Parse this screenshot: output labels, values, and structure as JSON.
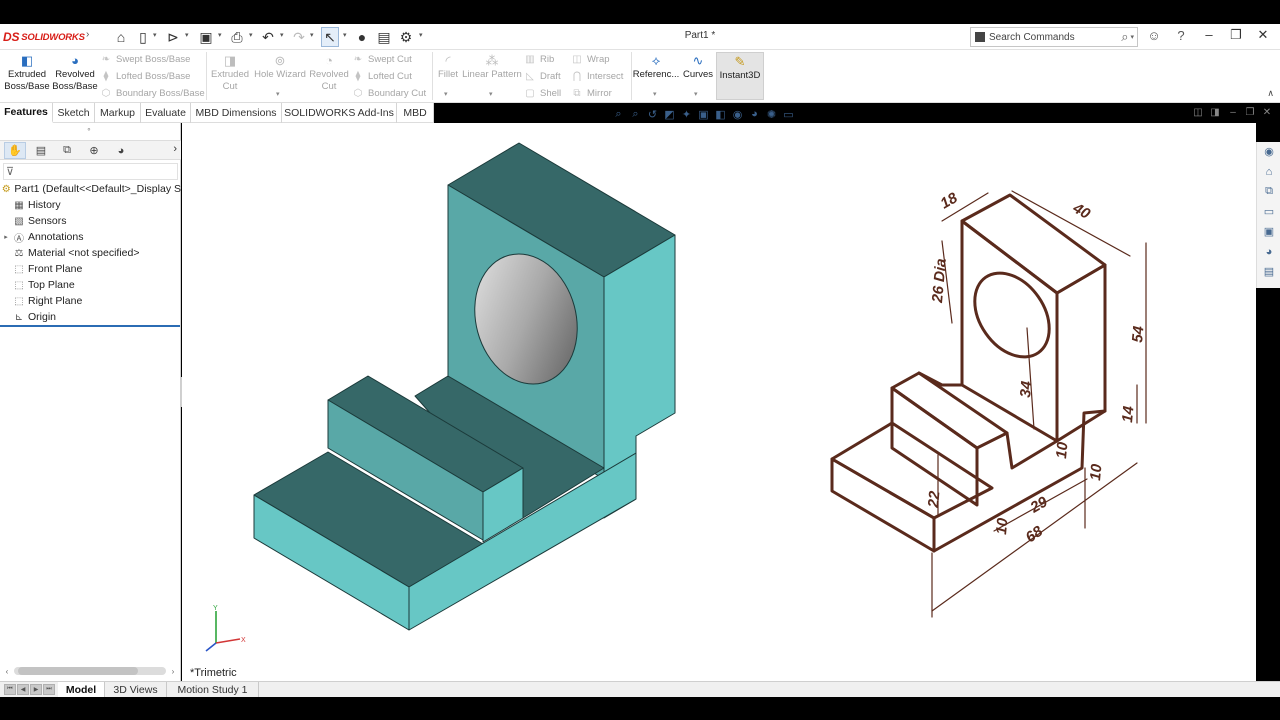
{
  "app": {
    "brand": "SOLIDWORKS",
    "document_title": "Part1 *"
  },
  "search": {
    "placeholder": "Search Commands"
  },
  "ribbon": {
    "extruded_boss": "Extruded Boss/Base",
    "revolved_boss": "Revolved Boss/Base",
    "swept_boss": "Swept Boss/Base",
    "lofted_boss": "Lofted Boss/Base",
    "boundary_boss": "Boundary Boss/Base",
    "extruded_cut": "Extruded Cut",
    "hole_wizard": "Hole Wizard",
    "revolved_cut": "Revolved Cut",
    "swept_cut": "Swept Cut",
    "lofted_cut": "Lofted Cut",
    "boundary_cut": "Boundary Cut",
    "fillet": "Fillet",
    "linear_pattern": "Linear Pattern",
    "rib": "Rib",
    "draft": "Draft",
    "shell": "Shell",
    "wrap": "Wrap",
    "intersect": "Intersect",
    "mirror": "Mirror",
    "reference": "Referenc...",
    "curves": "Curves",
    "instant3d": "Instant3D"
  },
  "command_tabs": [
    "Features",
    "Sketch",
    "Markup",
    "Evaluate",
    "MBD Dimensions",
    "SOLIDWORKS Add-Ins",
    "MBD"
  ],
  "feature_tree": {
    "part_name": "Part1  (Default<<Default>_Display S",
    "items": [
      {
        "label": "History",
        "icon": "history-icon"
      },
      {
        "label": "Sensors",
        "icon": "sensors-icon"
      },
      {
        "label": "Annotations",
        "icon": "annotations-icon"
      },
      {
        "label": "Material <not specified>",
        "icon": "material-icon"
      },
      {
        "label": "Front Plane",
        "icon": "plane-icon"
      },
      {
        "label": "Top Plane",
        "icon": "plane-icon"
      },
      {
        "label": "Right Plane",
        "icon": "plane-icon"
      },
      {
        "label": "Origin",
        "icon": "origin-icon"
      }
    ]
  },
  "viewport": {
    "view_label": "*Trimetric",
    "triad": {
      "x": "X",
      "y": "Y"
    },
    "model_colors": {
      "top": "#366868",
      "front": "#59a8a7",
      "side": "#67c7c5",
      "hole": "#a9a9a9"
    }
  },
  "drawing": {
    "dimensions": {
      "d18": "18",
      "d40": "40",
      "d26": "26 Dia",
      "d54": "54",
      "d34": "34",
      "d14": "14",
      "d22": "22",
      "d10a": "10",
      "d10b": "10",
      "d10c": "10",
      "d29": "29",
      "d68": "68"
    },
    "ink_color": "#5a2a1c"
  },
  "bottom_tabs": [
    "Model",
    "3D Views",
    "Motion Study 1"
  ]
}
